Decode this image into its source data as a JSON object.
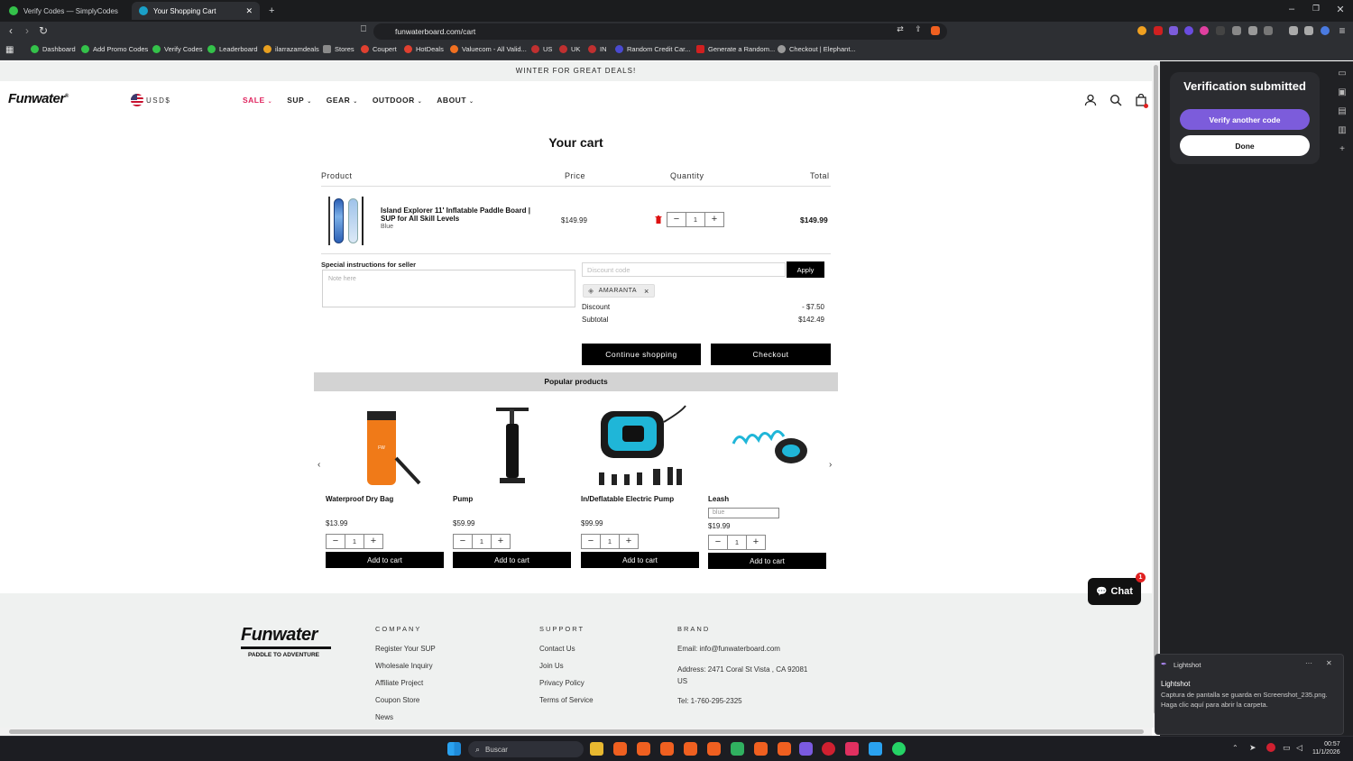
{
  "browser": {
    "tabs": [
      {
        "title": "Verify Codes — SimplyCodes",
        "favicon_color": "#34c24a"
      },
      {
        "title": "Your Shopping Cart",
        "favicon_color": "#1aa0c8"
      }
    ],
    "new_tab": "+",
    "url": "funwaterboard.com/cart",
    "bookmarks": [
      {
        "label": "Dashboard",
        "color": "#34c24a"
      },
      {
        "label": "Add Promo Codes",
        "color": "#34c24a"
      },
      {
        "label": "Verify Codes",
        "color": "#34c24a"
      },
      {
        "label": "Leaderboard",
        "color": "#34c24a"
      },
      {
        "label": "ilarrazamdeals",
        "color": "#e8a020"
      },
      {
        "label": "Stores",
        "color": "#8a8a8a"
      },
      {
        "label": "Coupert",
        "color": "#e04030"
      },
      {
        "label": "HotDeals",
        "color": "#e04030"
      },
      {
        "label": "Valuecom - All Valid...",
        "color": "#f07020"
      },
      {
        "label": "US",
        "color": "#c03030"
      },
      {
        "label": "UK",
        "color": "#c03030"
      },
      {
        "label": "IN",
        "color": "#c03030"
      },
      {
        "label": "Random Credit Car...",
        "color": "#4a4ad0"
      },
      {
        "label": "Generate a Random...",
        "color": "#d02020"
      },
      {
        "label": "Checkout | Elephant...",
        "color": "#9a9a9a"
      }
    ]
  },
  "site": {
    "announcement": "WINTER FOR GREAT DEALS!",
    "logo": "Funwater",
    "currency": "USD$",
    "nav": [
      {
        "label": "SALE",
        "color": "#e0245e"
      },
      {
        "label": "SUP",
        "color": "#222222"
      },
      {
        "label": "GEAR",
        "color": "#222222"
      },
      {
        "label": "OUTDOOR",
        "color": "#222222"
      },
      {
        "label": "ABOUT",
        "color": "#222222"
      }
    ]
  },
  "cart": {
    "title": "Your cart",
    "columns": {
      "product": "Product",
      "price": "Price",
      "quantity": "Quantity",
      "total": "Total"
    },
    "item": {
      "name": "Island Explorer 11' Inflatable Paddle Board | SUP for All Skill Levels",
      "variant": "Blue",
      "price": "$149.99",
      "quantity": "1",
      "total": "$149.99"
    },
    "instructions_label": "Special instructions for seller",
    "note_placeholder": "Note here",
    "discount_placeholder": "Discount code",
    "apply_label": "Apply",
    "applied_code": "AMARANTA",
    "discount_label": "Discount",
    "discount_value": "- $7.50",
    "subtotal_label": "Subtotal",
    "subtotal_value": "$142.49",
    "continue_label": "Continue shopping",
    "checkout_label": "Checkout"
  },
  "popular": {
    "title": "Popular products",
    "products": [
      {
        "name": "Waterproof Dry Bag",
        "price": "$13.99",
        "qty": "1",
        "button": "Add to cart"
      },
      {
        "name": "Pump",
        "price": "$59.99",
        "qty": "1",
        "button": "Add to cart"
      },
      {
        "name": "In/Deflatable Electric Pump",
        "price": "$99.99",
        "qty": "1",
        "button": "Add to cart"
      },
      {
        "name": "Leash",
        "price": "$19.99",
        "qty": "1",
        "button": "Add to cart",
        "variant": "blue"
      }
    ]
  },
  "footer": {
    "logo_text": "Funwater",
    "tagline": "PADDLE TO ADVENTURE",
    "company": {
      "heading": "COMPANY",
      "links": [
        "Register Your SUP",
        "Wholesale Inquiry",
        "Affiliate Project",
        "Coupon Store",
        "News"
      ]
    },
    "support": {
      "heading": "SUPPORT",
      "links": [
        "Contact Us",
        "Join Us",
        "Privacy Policy",
        "Terms of Service"
      ]
    },
    "brand": {
      "heading": "BRAND",
      "email": "Email: info@funwaterboard.com",
      "address": "Address: 2471 Coral St Vista , CA 92081 US",
      "tel": "Tel: 1-760-295-2325"
    },
    "chat_label": "Chat",
    "chat_badge": "1"
  },
  "extension": {
    "title": "Verification submitted",
    "verify_another": "Verify another code",
    "done": "Done",
    "accent": "#7c5cdb"
  },
  "notification": {
    "app": "Lightshot",
    "title": "Lightshot",
    "body": "Captura de pantalla se guarda en Screenshot_235.png. Haga clic aquí para abrir la carpeta.",
    "more": "···",
    "close": "✕"
  },
  "taskbar": {
    "search": "Buscar",
    "time": "00:57",
    "date": "11/1/2026"
  }
}
